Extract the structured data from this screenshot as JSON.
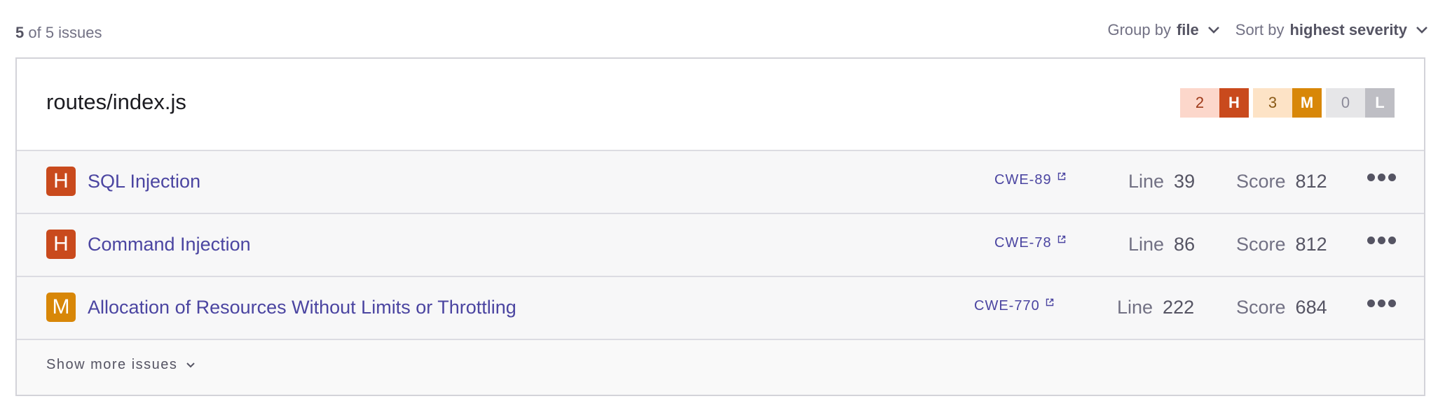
{
  "summary": {
    "count_bold": "5",
    "count_rest": " of 5 issues"
  },
  "group_by": {
    "label": "Group by",
    "value": "file"
  },
  "sort_by": {
    "label": "Sort by",
    "value": "highest severity"
  },
  "file": {
    "name": "routes/index.js",
    "counts": [
      {
        "count": "2",
        "letter": "H",
        "num_bg": "#fcd7cb",
        "num_color": "#9e3a1a",
        "sev_bg": "#c94a1d"
      },
      {
        "count": "3",
        "letter": "M",
        "num_bg": "#fde3c6",
        "num_color": "#8a5a16",
        "sev_bg": "#d88708"
      },
      {
        "count": "0",
        "letter": "L",
        "num_bg": "#e6e6e8",
        "num_color": "#8b8a98",
        "sev_bg": "#bebec4"
      }
    ]
  },
  "issues": [
    {
      "severity": "H",
      "severity_color": "#c94a1d",
      "title": "SQL Injection",
      "cwe": "CWE-89",
      "line_label": "Line",
      "line": "39",
      "score_label": "Score",
      "score": "812"
    },
    {
      "severity": "H",
      "severity_color": "#c94a1d",
      "title": "Command Injection",
      "cwe": "CWE-78",
      "line_label": "Line",
      "line": "86",
      "score_label": "Score",
      "score": "812"
    },
    {
      "severity": "M",
      "severity_color": "#d88708",
      "title": "Allocation of Resources Without Limits or Throttling",
      "cwe": "CWE-770",
      "line_label": "Line",
      "line": "222",
      "score_label": "Score",
      "score": "684"
    }
  ],
  "show_more": "Show more issues"
}
